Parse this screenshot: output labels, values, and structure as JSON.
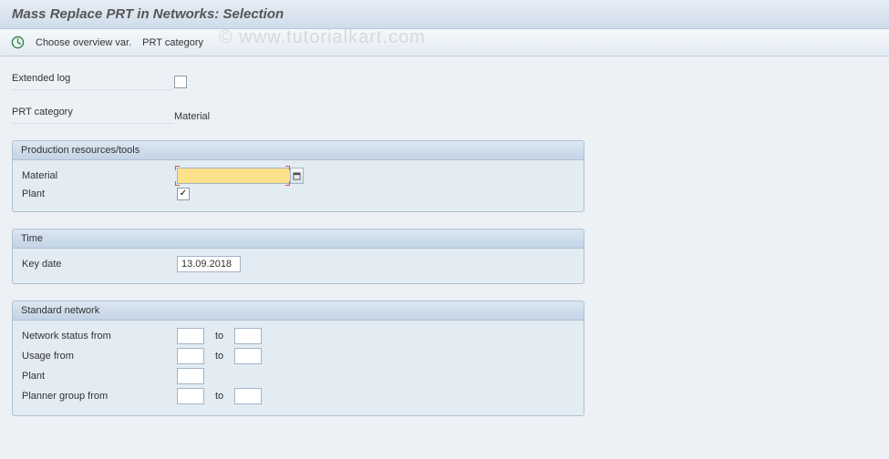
{
  "title": "Mass Replace PRT in Networks: Selection",
  "watermark": "© www.tutorialkart.com",
  "toolbar": {
    "overview": "Choose overview var.",
    "prt_category": "PRT category"
  },
  "top": {
    "extended_log_label": "Extended log",
    "extended_log_checked": false,
    "prt_category_label": "PRT category",
    "prt_category_value": "Material"
  },
  "group_prt": {
    "header": "Production resources/tools",
    "material_label": "Material",
    "material_value": "",
    "plant_label": "Plant",
    "plant_checked": true
  },
  "group_time": {
    "header": "Time",
    "keydate_label": "Key date",
    "keydate_value": "13.09.2018"
  },
  "group_std": {
    "header": "Standard network",
    "net_status_label": "Network status from",
    "usage_label": "Usage from",
    "plant_label": "Plant",
    "planner_label": "Planner group from",
    "to_label": "to",
    "net_status_from": "",
    "net_status_to": "",
    "usage_from": "",
    "usage_to": "",
    "plant_value": "",
    "planner_from": "",
    "planner_to": ""
  }
}
